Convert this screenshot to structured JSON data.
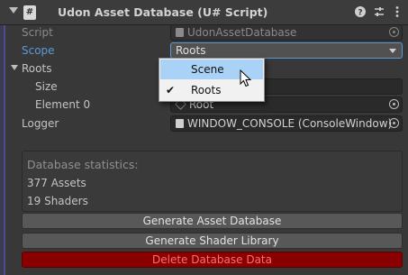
{
  "header": {
    "title": "Udon Asset Database (U# Script)",
    "script_icon_glyph": "#",
    "icons": [
      "help-icon",
      "preset-sliders-icon",
      "more-options-icon"
    ]
  },
  "fields": {
    "script_label": "Script",
    "script_value": "UdonAssetDatabase",
    "scope_label": "Scope",
    "scope_value": "Roots",
    "roots_label": "Roots",
    "size_label": "Size",
    "element0_label": "Element 0",
    "element0_value": "Root",
    "logger_label": "Logger",
    "logger_value": "WINDOW_CONSOLE (ConsoleWindow)"
  },
  "scope_popup": {
    "options": [
      {
        "label": "Scene",
        "checked": false,
        "highlighted": true
      },
      {
        "label": "Roots",
        "checked": true,
        "highlighted": false
      }
    ]
  },
  "stats": {
    "heading": "Database statistics:",
    "assets": "377 Assets",
    "shaders": "19 Shaders"
  },
  "buttons": {
    "generate_db": "Generate Asset Database",
    "generate_shader": "Generate Shader Library",
    "delete_data": "Delete Database Data"
  },
  "colors": {
    "accent_blue": "#5b9bd5",
    "danger_bg": "#8a0000",
    "danger_text": "#ff6e6e",
    "popup_highlight": "#a9d2f6"
  }
}
